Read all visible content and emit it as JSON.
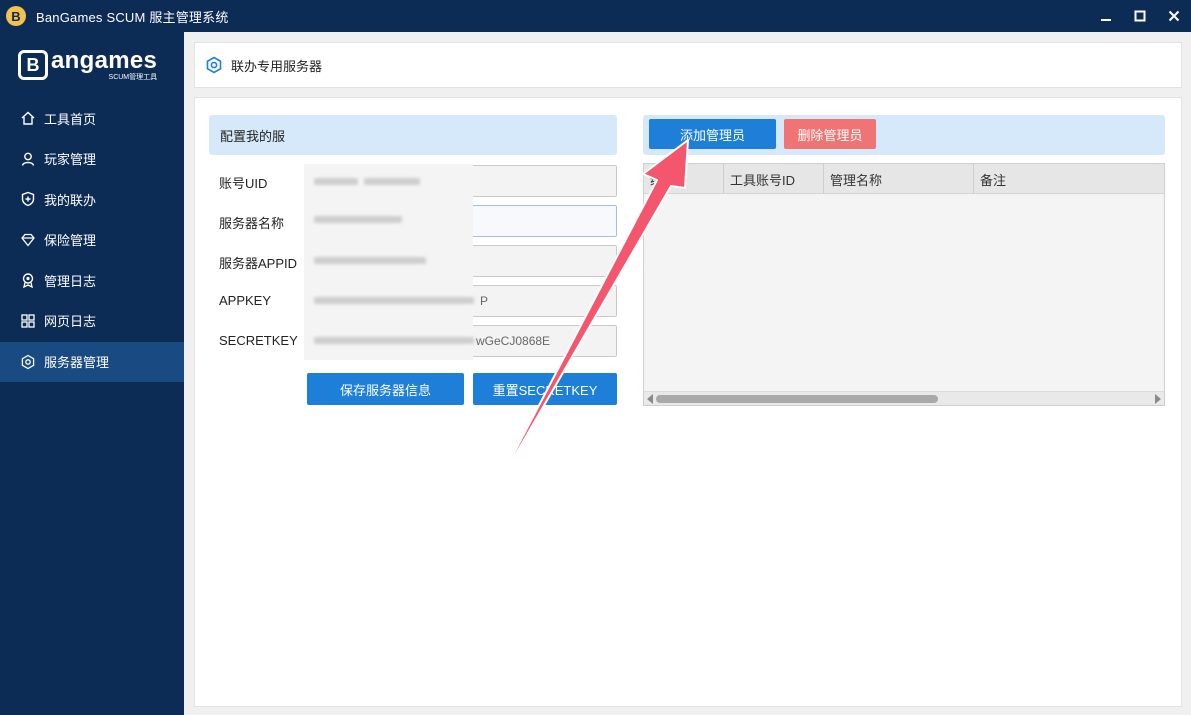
{
  "window": {
    "title": "BanGames SCUM 服主管理系统",
    "logo_letter": "B",
    "minimize_glyph": "—",
    "maximize_glyph": "☐",
    "close_glyph": "✕"
  },
  "sidebar": {
    "brand_mark": "B",
    "brand_name": "angames",
    "brand_sub": "SCUM管理工具",
    "items": [
      {
        "label": "工具首页",
        "icon": "home-icon"
      },
      {
        "label": "玩家管理",
        "icon": "user-icon"
      },
      {
        "label": "我的联办",
        "icon": "shield-plus-icon"
      },
      {
        "label": "保险管理",
        "icon": "diamond-icon"
      },
      {
        "label": "管理日志",
        "icon": "badge-icon"
      },
      {
        "label": "网页日志",
        "icon": "grid-icon"
      },
      {
        "label": "服务器管理",
        "icon": "gear-icon",
        "active": true
      }
    ]
  },
  "header": {
    "title": "联办专用服务器",
    "icon": "hexagon-gear-icon"
  },
  "config": {
    "title": "配置我的服",
    "fields": [
      {
        "label": "账号UID",
        "value": ""
      },
      {
        "label": "服务器名称",
        "value": ""
      },
      {
        "label": "服务器APPID",
        "value": ""
      },
      {
        "label": "APPKEY",
        "value": "P"
      },
      {
        "label": "SECRETKEY",
        "value": "wGeCJ0868E"
      }
    ],
    "save_label": "保存服务器信息",
    "reset_label": "重置SECRETKEY"
  },
  "admins": {
    "add_label": "添加管理员",
    "delete_label": "删除管理员",
    "columns": [
      "编",
      "工具账号ID",
      "管理名称",
      "备注"
    ]
  },
  "colors": {
    "sidebar_bg": "#0d2c55",
    "accent_blue": "#1e7fd9",
    "danger_red": "#f07474",
    "section_header": "#d6e9fb",
    "annotation_arrow": "#f4566e"
  }
}
